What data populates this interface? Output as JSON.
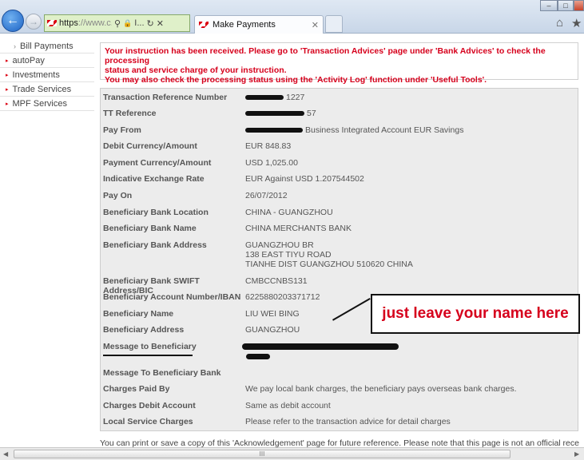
{
  "browser": {
    "url_scheme": "https",
    "url_rest": "://www.c...",
    "tab_title": "Make Payments",
    "tab_close": "✕",
    "addr_search": "⚲",
    "addr_lock": "🔒",
    "addr_lock_text": "I...",
    "addr_refresh": "↻",
    "addr_stop": "✕",
    "back_glyph": "←",
    "fwd_glyph": "→",
    "minimize": "–",
    "maximize": "□",
    "home_glyph": "⌂",
    "star_glyph": "★"
  },
  "sidebar": {
    "items": [
      {
        "label": "Bill Payments",
        "sub": true
      },
      {
        "label": "autoPay",
        "sub": false
      },
      {
        "label": "Investments",
        "sub": false
      },
      {
        "label": "Trade Services",
        "sub": false
      },
      {
        "label": "MPF Services",
        "sub": false
      }
    ]
  },
  "message": {
    "line1": "Your instruction has been received. Please go to 'Transaction Advices' page under 'Bank Advices' to check the processing",
    "line2": "status and service charge of your instruction.",
    "line3": "You may also check the processing status using the 'Activity Log' function under 'Useful Tools'."
  },
  "details": [
    {
      "label": "Transaction Reference Number",
      "value": "1227",
      "redacted": true
    },
    {
      "label": "TT Reference",
      "value": "57",
      "redacted": true
    },
    {
      "label": "Pay From",
      "value": "Business Integrated Account EUR Savings",
      "redacted": true
    },
    {
      "label": "Debit Currency/Amount",
      "value": "EUR 848.83"
    },
    {
      "label": "Payment Currency/Amount",
      "value": "USD 1,025.00"
    },
    {
      "label": "Indicative Exchange Rate",
      "value": "EUR Against USD 1.207544502"
    },
    {
      "label": "Pay On",
      "value": "26/07/2012"
    },
    {
      "label": "Beneficiary Bank Location",
      "value": "CHINA - GUANGZHOU"
    },
    {
      "label": "Beneficiary Bank Name",
      "value": "CHINA MERCHANTS BANK"
    },
    {
      "label": "Beneficiary Bank Address",
      "lines": [
        "GUANGZHOU BR",
        "138 EAST TIYU ROAD",
        "TIANHE DIST GUANGZHOU 510620 CHINA"
      ]
    },
    {
      "label": "Beneficiary Bank SWIFT Address/BIC",
      "value": "CMBCCNBS131"
    },
    {
      "label": "Beneficiary Account Number/IBAN",
      "value": "6225880203371712"
    },
    {
      "label": "Beneficiary Name",
      "value": "LIU WEI BING"
    },
    {
      "label": "Beneficiary Address",
      "value": "GUANGZHOU"
    },
    {
      "label": "Message to Beneficiary",
      "value": ""
    },
    {
      "label": "Message To Beneficiary Bank",
      "value": ""
    },
    {
      "label": "Charges Paid By",
      "value": "We pay local bank charges, the beneficiary pays overseas bank charges."
    },
    {
      "label": "Charges Debit Account",
      "value": "Same as debit account"
    },
    {
      "label": "Local Service Charges",
      "value": "Please refer to the transaction advice for detail charges"
    }
  ],
  "annotation": {
    "callout_text": "just leave your name here"
  },
  "footer": {
    "note": "You can print or save a copy of this 'Acknowledgement' page for future reference. Please note that this page is not an official receipt of"
  },
  "scrollbar": {
    "left_arrow": "◀",
    "right_arrow": "▶",
    "grip": "III"
  },
  "colors": {
    "brand_red": "#db0011",
    "message_red": "#d6001c",
    "panel_bg": "#ececec"
  }
}
